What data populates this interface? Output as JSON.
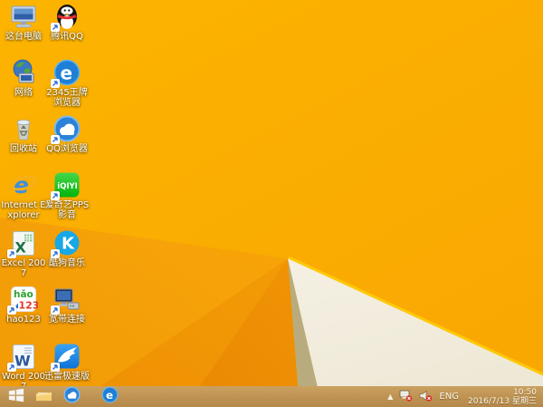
{
  "desktop": {
    "icons": [
      {
        "label": "这台电脑",
        "icon": "computer-icon",
        "shortcut": false
      },
      {
        "label": "腾讯QQ",
        "icon": "qq-icon",
        "shortcut": true
      },
      {
        "label": "网络",
        "icon": "network-icon",
        "shortcut": false
      },
      {
        "label": "2345王牌浏览器",
        "icon": "browser-2345-icon",
        "shortcut": true,
        "glyph": "e"
      },
      {
        "label": "回收站",
        "icon": "recycle-bin-icon",
        "shortcut": false
      },
      {
        "label": "QQ浏览器",
        "icon": "qq-browser-icon",
        "shortcut": true
      },
      {
        "label": "Internet Explorer",
        "icon": "ie-icon",
        "shortcut": false,
        "glyph": "e"
      },
      {
        "label": "爱奇艺PPS影音",
        "icon": "iqiyi-icon",
        "shortcut": true,
        "glyph": "iQIYI"
      },
      {
        "label": "Excel 2007",
        "icon": "excel-icon",
        "shortcut": true,
        "glyph": "X"
      },
      {
        "label": "酷狗音乐",
        "icon": "kugou-icon",
        "shortcut": true,
        "glyph": "K"
      },
      {
        "label": "hao123",
        "icon": "hao123-icon",
        "shortcut": true,
        "glyph": "hǎo",
        "glyph2": "123"
      },
      {
        "label": "宽带连接",
        "icon": "broadband-icon",
        "shortcut": true
      },
      {
        "label": "Word 2007",
        "icon": "word-icon",
        "shortcut": true,
        "glyph": "W"
      },
      {
        "label": "迅雷极速版",
        "icon": "thunder-icon",
        "shortcut": true
      }
    ]
  },
  "taskbar": {
    "buttons": [
      {
        "name": "start-button",
        "icon": "windows-logo-icon"
      },
      {
        "name": "file-explorer-button",
        "icon": "folder-icon"
      },
      {
        "name": "qq-browser-button",
        "icon": "qq-browser-icon"
      },
      {
        "name": "browser-2345-button",
        "icon": "browser-e-icon",
        "glyph": "e"
      }
    ],
    "tray": {
      "expand_glyph": "▲",
      "language": "ENG",
      "time": "10:50",
      "date": "2016/7/13 星期三"
    }
  },
  "wallpaper": {
    "base_color": "#FBAE02",
    "facet_mid": "#F6A007",
    "facet_dark": "#ED8D04",
    "khaki_wedge": "#B8AC7F",
    "cream_wedge": "#F3EEE0",
    "highlight_line": "#FFC806",
    "taskbar_color": "#BD9150"
  }
}
